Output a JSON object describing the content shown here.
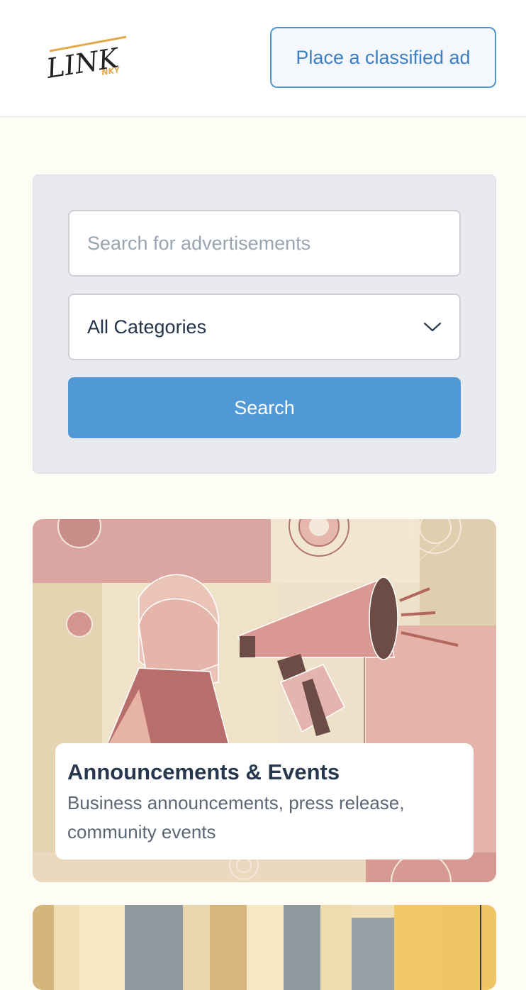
{
  "header": {
    "logo_text": "LINK",
    "logo_subtext": "NKY",
    "place_ad_label": "Place a classified ad"
  },
  "search": {
    "placeholder": "Search for advertisements",
    "value": "",
    "category_selected": "All Categories",
    "button_label": "Search"
  },
  "cards": [
    {
      "title": "Announcements & Events",
      "description": "Business announcements, press release, community events",
      "image_icon": "megaphone-illustration"
    },
    {
      "title": "",
      "description": "",
      "image_icon": "striped-illustration"
    }
  ],
  "colors": {
    "accent": "#5199d6",
    "logo_underline": "#e2a94a",
    "page_background": "#fdfdf6"
  }
}
